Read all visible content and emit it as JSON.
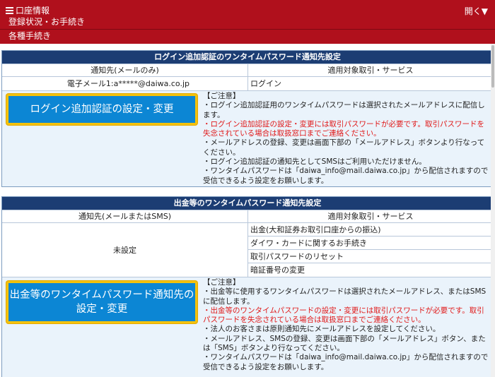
{
  "header": {
    "title": "口座情報",
    "open_label": "開く▼",
    "breadcrumb": "登録状況・お手続き",
    "subtitle": "各種手続き"
  },
  "login_section": {
    "title": "ログイン追加認証のワンタイムパスワード通知先設定",
    "col_destination": "通知先(メールのみ)",
    "col_service": "適用対象取引・サービス",
    "destination_value": "電子メール1:a*****@daiwa.co.jp",
    "service_value": "ログイン",
    "button_label": "ログイン追加認証の設定・変更",
    "notes": {
      "heading": "【ご注意】",
      "line1": "・ログイン追加認証用のワンタイムパスワードは選択されたメールアドレスに配信します。",
      "red": "・ログイン追加認証の設定・変更には取引パスワードが必要です。取引パスワードを失念されている場合は取扱窓口までご連絡ください。",
      "line2": "・メールアドレスの登録、変更は画面下部の「メールアドレス」ボタンより行なってください。",
      "line3": "・ログイン追加認証の通知先としてSMSはご利用いただけません。",
      "line4": "・ワンタイムパスワードは「daiwa_info@mail.daiwa.co.jp」から配信されますので受信できるよう設定をお願いします。"
    }
  },
  "withdraw_section": {
    "title": "出金等のワンタイムパスワード通知先設定",
    "col_destination": "通知先(メールまたはSMS)",
    "col_service": "適用対象取引・サービス",
    "destination_value": "未設定",
    "services": [
      "出金(大和証券お取引口座からの振込)",
      "ダイワ・カードに関するお手続き",
      "取引パスワードのリセット",
      "暗証番号の変更"
    ],
    "button_line1": "出金等のワンタイムパスワード通知先の",
    "button_line2": "設定・変更",
    "notes": {
      "heading": "【ご注意】",
      "line1": "・出金等に使用するワンタイムパスワードは選択されたメールアドレス、またはSMSに配信します。",
      "red": "・出金等のワンタイムパスワードの設定・変更には取引パスワードが必要です。取引パスワードを失念されている場合は取扱窓口までご連絡ください。",
      "line2": "・法人のお客さまは原則通知先にメールアドレスを設定してください。",
      "line3": "・メールアドレス、SMSの登録、変更は画面下部の「メールアドレス」ボタン、または「SMS」ボタンより行なってください。",
      "line4": "・ワンタイムパスワードは「daiwa_info@mail.daiwa.co.jp」から配信されますので受信できるよう設定をお願いします。"
    }
  },
  "colors": {
    "header_red": "#b0101c",
    "section_navy": "#1c3d73",
    "button_blue": "#0c86d4",
    "button_border": "#f4c20d",
    "notice_red": "#e01818"
  }
}
